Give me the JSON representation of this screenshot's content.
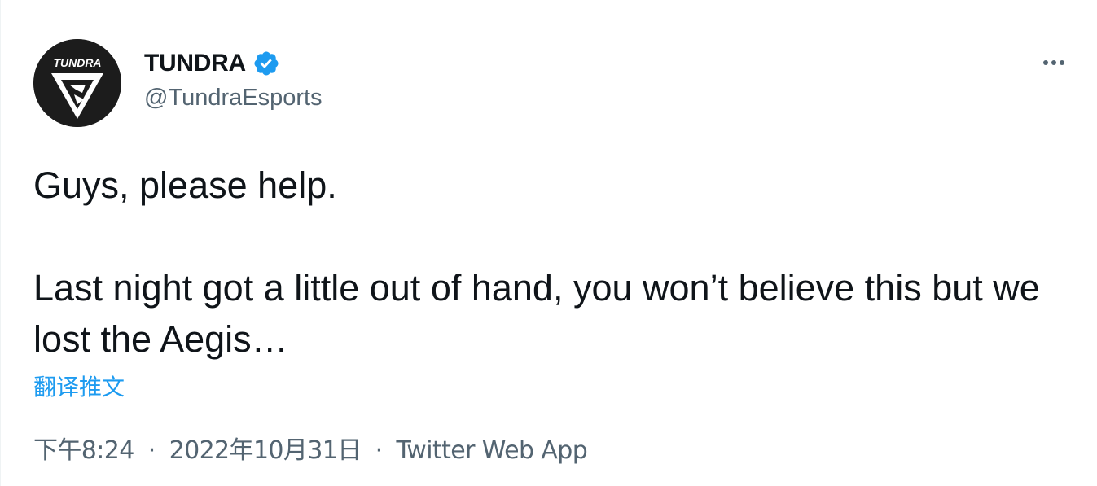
{
  "author": {
    "avatar_logo_text": "TUNDRA",
    "display_name": "TUNDRA",
    "verified": true,
    "handle": "@TundraEsports"
  },
  "tweet": {
    "line1": "Guys, please help.",
    "line2": "Last night got a little out of hand, you won’t believe this but we lost the Aegis…",
    "translate_label": "翻译推文"
  },
  "meta": {
    "time": "下午8:24",
    "separator": "·",
    "date": "2022年10月31日",
    "source": "Twitter Web App"
  },
  "colors": {
    "text_primary": "#0f1419",
    "text_secondary": "#536471",
    "accent": "#1d9bf0"
  },
  "icons": {
    "verified": "verified-badge-icon",
    "more": "more-options-icon"
  }
}
